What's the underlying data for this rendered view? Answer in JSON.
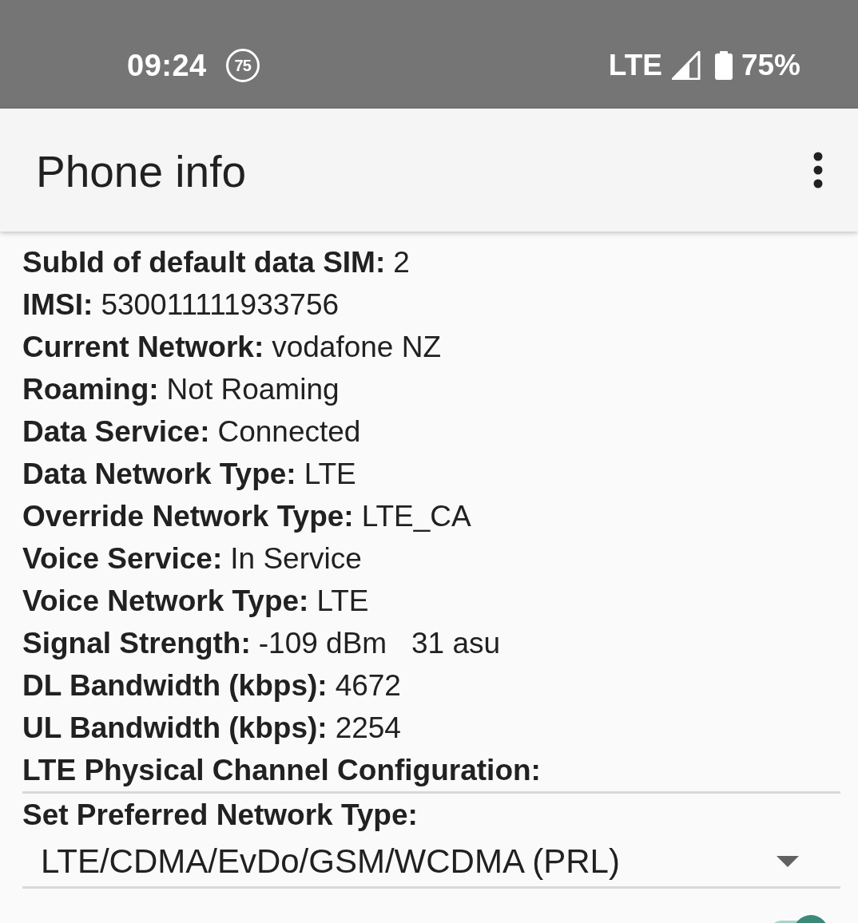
{
  "status_bar": {
    "time": "09:24",
    "notification_badge": "75",
    "network": "LTE",
    "battery": "75%"
  },
  "app_bar": {
    "title": "Phone info"
  },
  "info_rows": [
    {
      "label": "SubId of default data SIM:",
      "value": "2"
    },
    {
      "label": "IMSI:",
      "value": "530011111933756"
    },
    {
      "label": "Current Network:",
      "value": "vodafone NZ"
    },
    {
      "label": "Roaming:",
      "value": "Not Roaming"
    },
    {
      "label": "Data Service:",
      "value": "Connected"
    },
    {
      "label": "Data Network Type:",
      "value": "LTE"
    },
    {
      "label": "Override Network Type:",
      "value": "LTE_CA"
    },
    {
      "label": "Voice Service:",
      "value": "In Service"
    },
    {
      "label": "Voice Network Type:",
      "value": "LTE"
    },
    {
      "label": "Signal Strength:",
      "value": "-109 dBm   31 asu"
    },
    {
      "label": "DL Bandwidth (kbps):",
      "value": "4672"
    },
    {
      "label": "UL Bandwidth (kbps):",
      "value": "2254"
    },
    {
      "label": "LTE Physical Channel Configuration:"
    }
  ],
  "preferred_network": {
    "label": "Set Preferred Network Type:",
    "value": "LTE/CDMA/EvDo/GSM/WCDMA (PRL)"
  },
  "switch": {
    "on": true
  }
}
